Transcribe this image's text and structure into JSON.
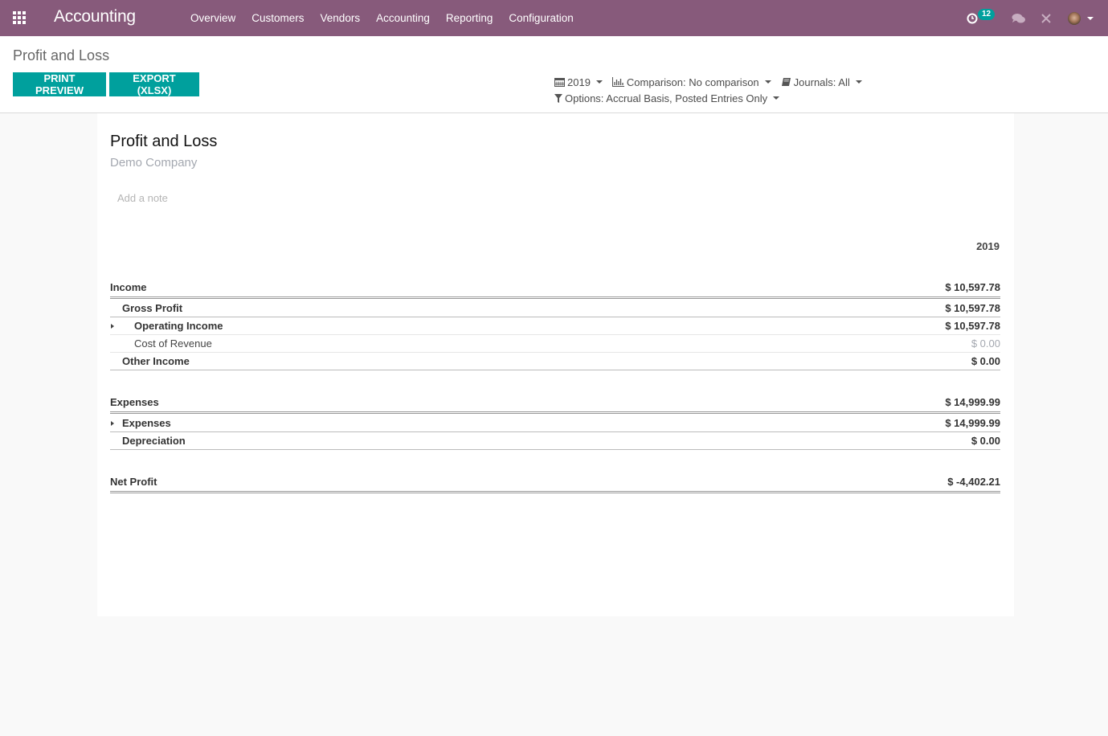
{
  "navbar": {
    "brand": "Accounting",
    "menu": [
      "Overview",
      "Customers",
      "Vendors",
      "Accounting",
      "Reporting",
      "Configuration"
    ],
    "activity_count": "12",
    "colors": {
      "brand": "#875a7b",
      "accent": "#00a09d"
    }
  },
  "control_panel": {
    "breadcrumb": "Profit and Loss",
    "buttons": {
      "print_preview": "PRINT PREVIEW",
      "export": "EXPORT (XLSX)"
    },
    "filters": {
      "date": "2019",
      "comparison": "Comparison: No comparison",
      "journals": "Journals: All",
      "options": "Options: Accrual Basis, Posted Entries Only"
    }
  },
  "report": {
    "title": "Profit and Loss",
    "company": "Demo Company",
    "note_placeholder": "Add a note",
    "column_header": "2019",
    "lines": [
      {
        "label": "Income",
        "value": "$ 10,597.78"
      },
      {
        "label": "Gross Profit",
        "value": "$ 10,597.78"
      },
      {
        "label": "Operating Income",
        "value": "$ 10,597.78",
        "expandable": true
      },
      {
        "label": "Cost of Revenue",
        "value": "$ 0.00"
      },
      {
        "label": "Other Income",
        "value": "$ 0.00"
      },
      {
        "label": "Expenses",
        "value": "$ 14,999.99"
      },
      {
        "label": "Expenses",
        "value": "$ 14,999.99",
        "expandable": true
      },
      {
        "label": "Depreciation",
        "value": "$ 0.00"
      },
      {
        "label": "Net Profit",
        "value": "$ -4,402.21"
      }
    ]
  }
}
